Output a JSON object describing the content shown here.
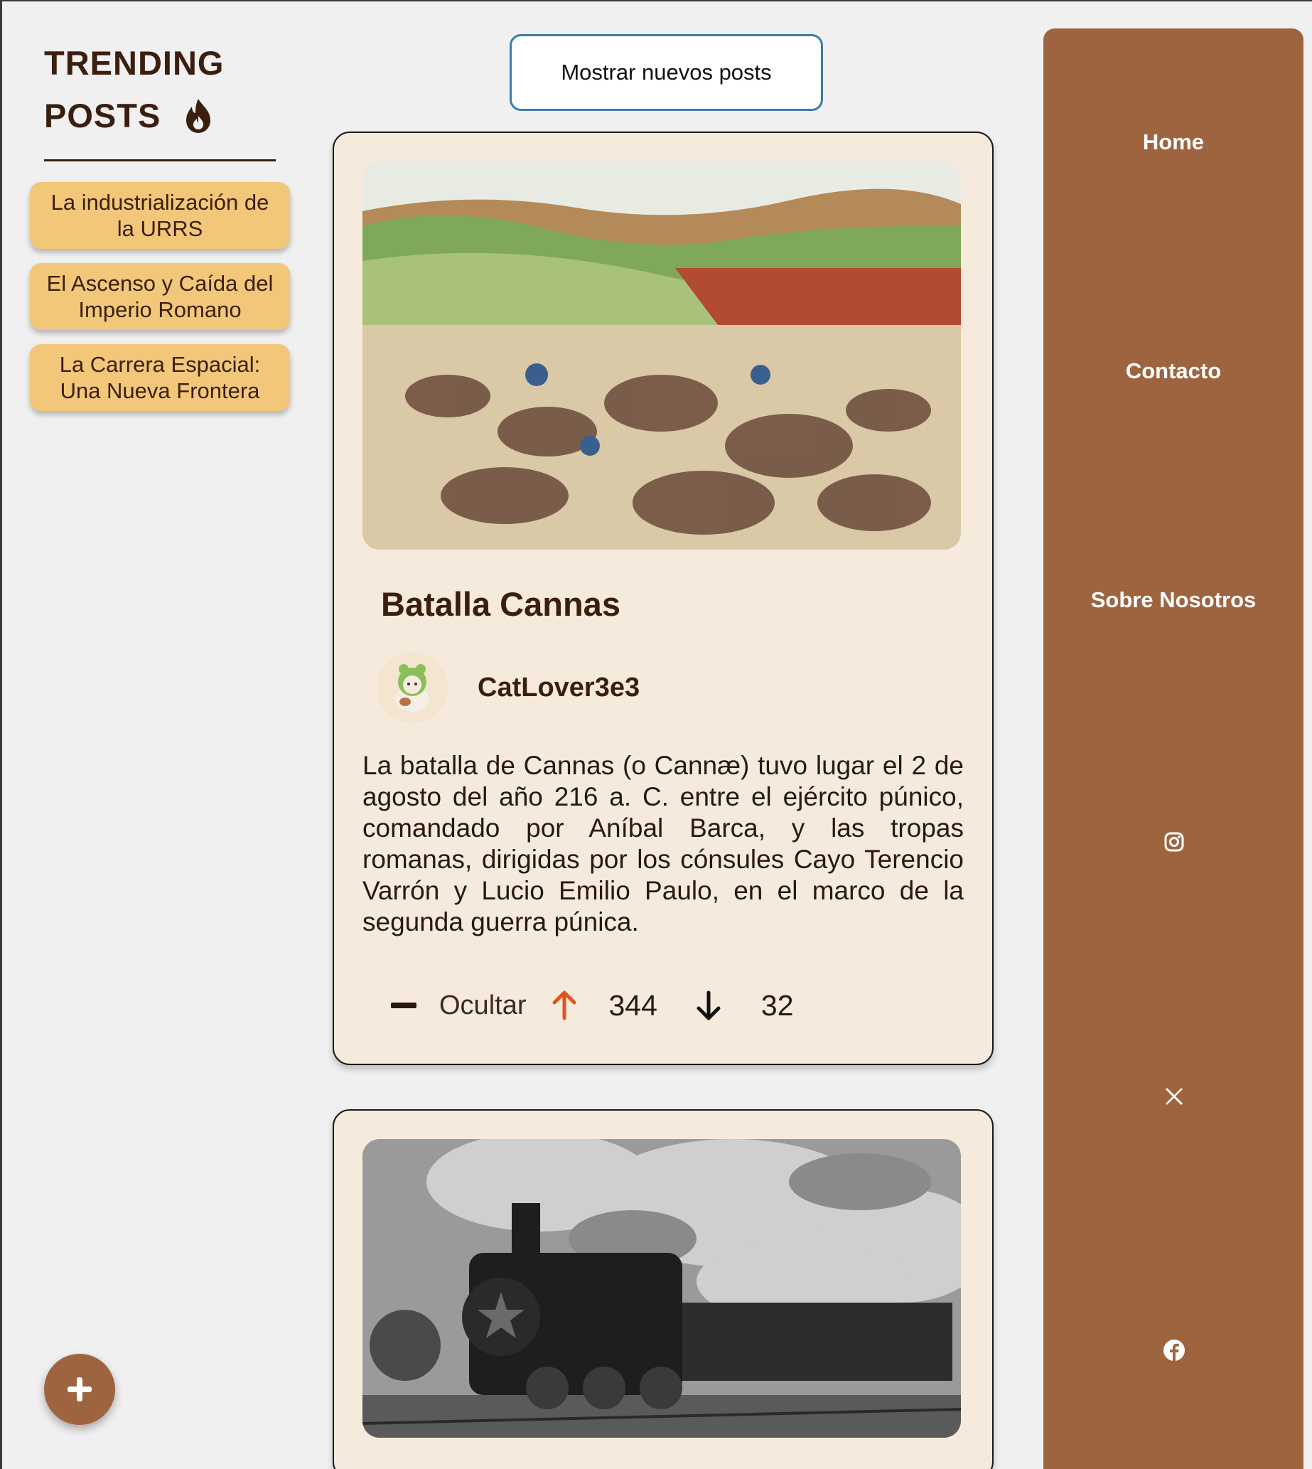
{
  "sidebar": {
    "title_line1": "TRENDING",
    "title_line2": "POSTS",
    "trending_items": [
      {
        "label": "La industrialización de la URRS"
      },
      {
        "label": "El Ascenso y Caída del Imperio Romano"
      },
      {
        "label": "La Carrera Espacial: Una Nueva Frontera"
      }
    ],
    "fab_icon": "plus-icon"
  },
  "feed": {
    "show_new_label": "Mostrar nuevos posts",
    "posts": [
      {
        "image_desc_icon": "battle-illustration",
        "title": "Batalla Cannas",
        "author": "CatLover3e3",
        "body": "La batalla de Cannas (o Cannæ) tuvo lugar el 2 de agosto del año 216 a. C. entre el ejército púnico, comandado por Aníbal Barca, y las tropas romanas, dirigidas por los cónsules Cayo Terencio Varrón y Lucio Emilio Paulo, en el marco de la segunda guerra púnica.",
        "hide_label": "Ocultar",
        "upvotes": "344",
        "downvotes": "32"
      },
      {
        "image_desc_icon": "steam-train-photo"
      }
    ]
  },
  "nav": {
    "home": "Home",
    "contact": "Contacto",
    "about": "Sobre Nosotros",
    "social": [
      "instagram-icon",
      "x-icon",
      "facebook-icon"
    ]
  },
  "colors": {
    "nav_bg": "#9e6440",
    "card_bg": "#f5eadb",
    "trend_bg": "#f2c77a",
    "text_dark": "#3b1f0e",
    "upvote": "#e0531f",
    "button_border": "#3a7ca8"
  }
}
